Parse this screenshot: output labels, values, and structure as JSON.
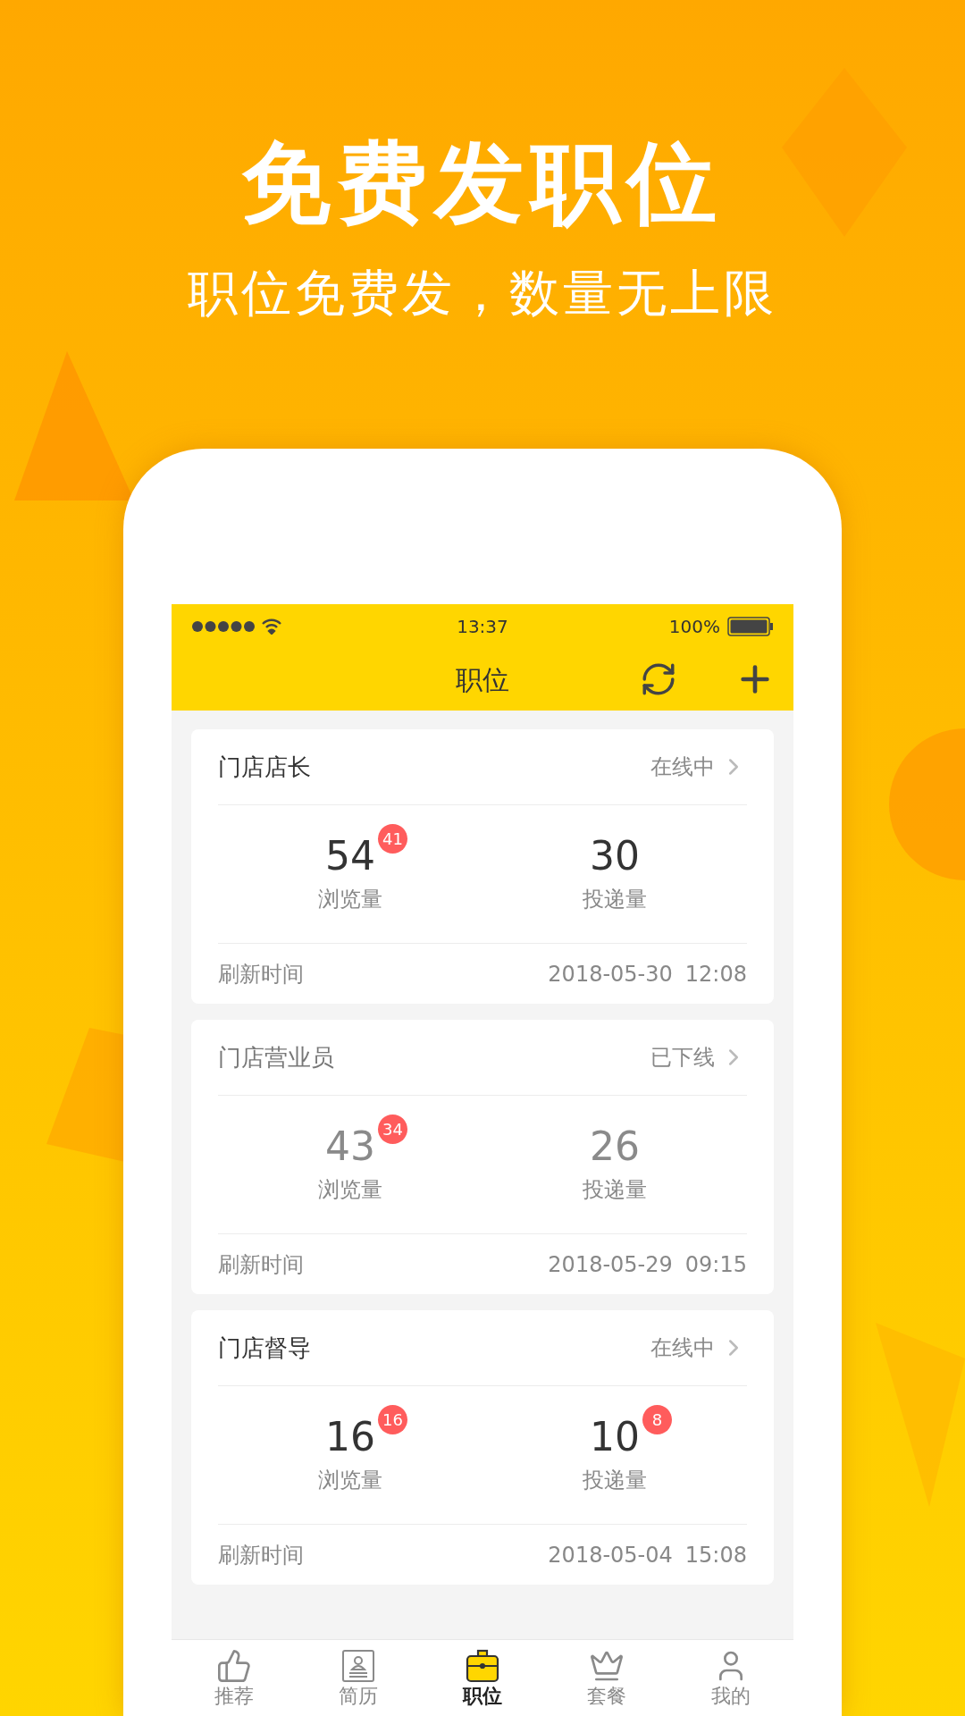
{
  "headline": "免费发职位",
  "subheadline": "职位免费发，数量无上限",
  "status_bar": {
    "time": "13:37",
    "battery": "100%"
  },
  "nav": {
    "title": "职位"
  },
  "jobs": [
    {
      "title": "门店店长",
      "status": "在线中",
      "online": true,
      "stats": [
        {
          "value": "54",
          "badge": "41",
          "label": "浏览量"
        },
        {
          "value": "30",
          "label": "投递量"
        }
      ],
      "refresh_label": "刷新时间",
      "refresh_date": "2018-05-30",
      "refresh_time": "12:08"
    },
    {
      "title": "门店营业员",
      "status": "已下线",
      "online": false,
      "stats": [
        {
          "value": "43",
          "badge": "34",
          "label": "浏览量"
        },
        {
          "value": "26",
          "label": "投递量"
        }
      ],
      "refresh_label": "刷新时间",
      "refresh_date": "2018-05-29",
      "refresh_time": "09:15"
    },
    {
      "title": "门店督导",
      "status": "在线中",
      "online": true,
      "stats": [
        {
          "value": "16",
          "badge": "16",
          "label": "浏览量"
        },
        {
          "value": "10",
          "badge": "8",
          "label": "投递量"
        }
      ],
      "refresh_label": "刷新时间",
      "refresh_date": "2018-05-04",
      "refresh_time": "15:08"
    }
  ],
  "tabs": [
    {
      "label": "推荐",
      "kind": "thumb",
      "selected": false
    },
    {
      "label": "简历",
      "kind": "resume",
      "selected": false
    },
    {
      "label": "职位",
      "kind": "briefcase",
      "selected": true
    },
    {
      "label": "套餐",
      "kind": "crown",
      "selected": false
    },
    {
      "label": "我的",
      "kind": "user",
      "selected": false
    }
  ]
}
